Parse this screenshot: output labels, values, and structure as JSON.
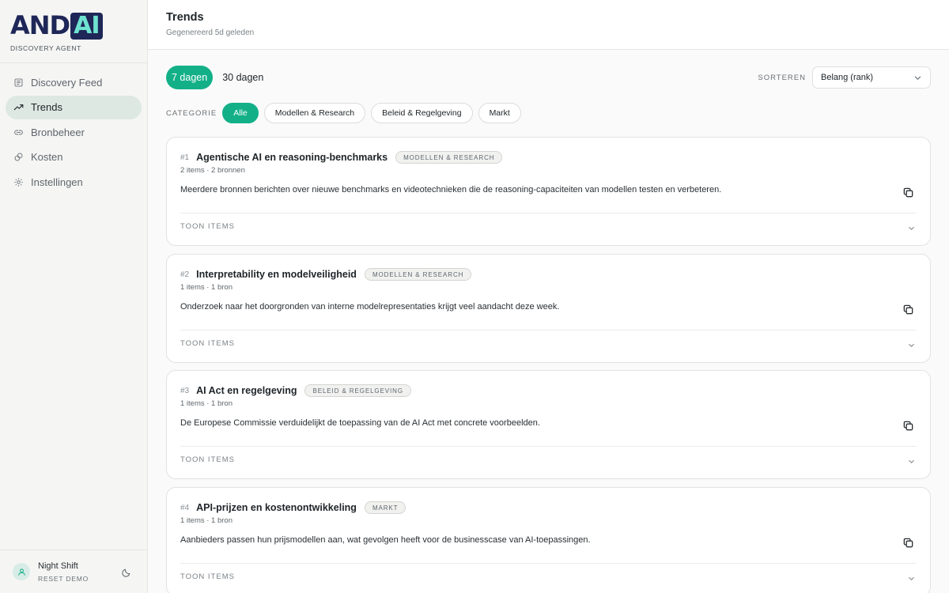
{
  "brand": {
    "logo_left": "AND",
    "logo_right": "AI",
    "subtitle": "DISCOVERY AGENT",
    "colors": {
      "navy": "#1e2757",
      "teal": "#6fe3d0"
    }
  },
  "sidebar": {
    "items": [
      {
        "label": "Discovery Feed",
        "icon": "newspaper-icon",
        "active": false
      },
      {
        "label": "Trends",
        "icon": "trending-up-icon",
        "active": true
      },
      {
        "label": "Bronbeheer",
        "icon": "link-icon",
        "active": false
      },
      {
        "label": "Kosten",
        "icon": "coins-icon",
        "active": false
      },
      {
        "label": "Instellingen",
        "icon": "gear-icon",
        "active": false
      }
    ]
  },
  "user": {
    "name": "Night Shift",
    "action": "RESET DEMO",
    "avatar_icon": "user-icon",
    "theme_icon": "moon-icon"
  },
  "header": {
    "title": "Trends",
    "subtitle": "Gegenereerd 5d geleden"
  },
  "filters": {
    "ranges": [
      {
        "label": "7 dagen",
        "active": true
      },
      {
        "label": "30 dagen",
        "active": false
      }
    ],
    "sort_label": "SORTEREN",
    "sort_value": "Belang (rank)",
    "category_label": "CATEGORIE",
    "categories": [
      {
        "label": "Alle",
        "active": true
      },
      {
        "label": "Modellen & Research",
        "active": false
      },
      {
        "label": "Beleid & Regelgeving",
        "active": false
      },
      {
        "label": "Markt",
        "active": false
      }
    ],
    "accent_color": "#13b088"
  },
  "trends": [
    {
      "rank": "#1",
      "title": "Agentische AI en reasoning-benchmarks",
      "tag": "MODELLEN & RESEARCH",
      "meta": "2 items · 2 bronnen",
      "description": "Meerdere bronnen berichten over nieuwe benchmarks en videotechnieken die de reasoning-capaciteiten van modellen testen en verbeteren.",
      "toggle": "TOON ITEMS"
    },
    {
      "rank": "#2",
      "title": "Interpretability en modelveiligheid",
      "tag": "MODELLEN & RESEARCH",
      "meta": "1 items · 1 bron",
      "description": "Onderzoek naar het doorgronden van interne modelrepresentaties krijgt veel aandacht deze week.",
      "toggle": "TOON ITEMS"
    },
    {
      "rank": "#3",
      "title": "AI Act en regelgeving",
      "tag": "BELEID & REGELGEVING",
      "meta": "1 items · 1 bron",
      "description": "De Europese Commissie verduidelijkt de toepassing van de AI Act met concrete voorbeelden.",
      "toggle": "TOON ITEMS"
    },
    {
      "rank": "#4",
      "title": "API-prijzen en kostenontwikkeling",
      "tag": "MARKT",
      "meta": "1 items · 1 bron",
      "description": "Aanbieders passen hun prijsmodellen aan, wat gevolgen heeft voor de businesscase van AI-toepassingen.",
      "toggle": "TOON ITEMS"
    }
  ]
}
